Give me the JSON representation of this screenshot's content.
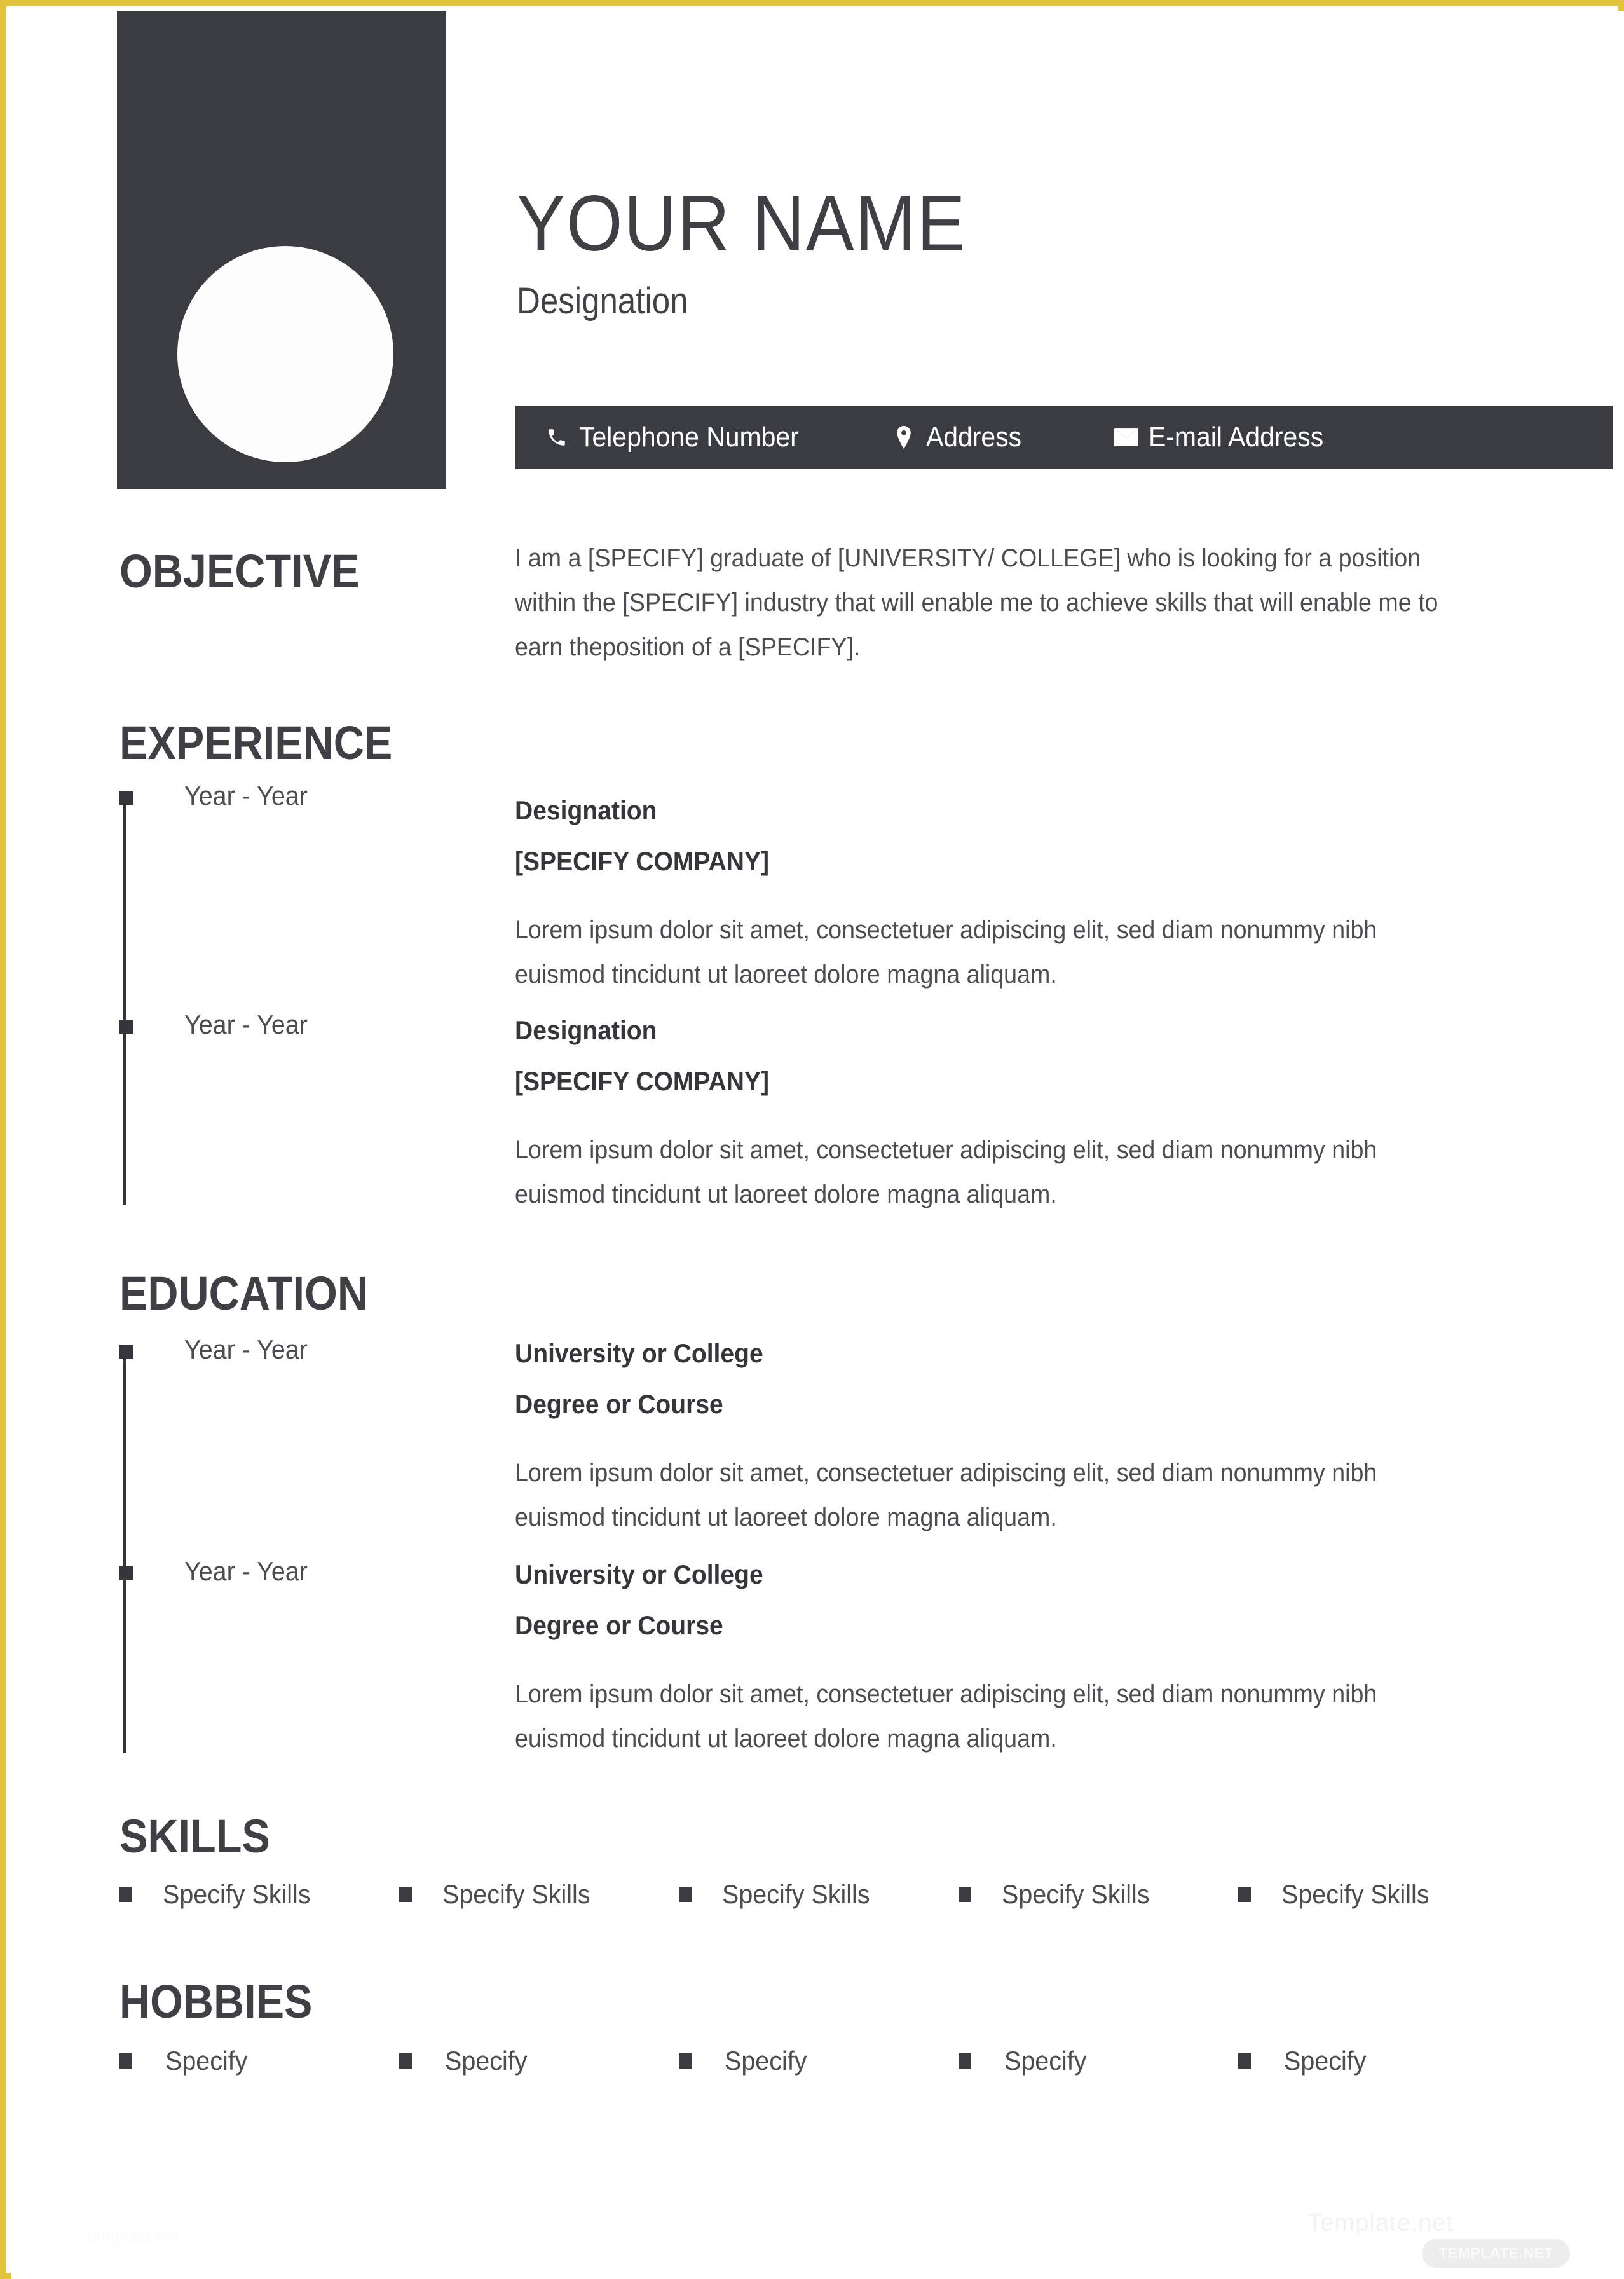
{
  "colors": {
    "frame_gold": "#e3c33c",
    "dark_panel": "#3b3c41",
    "heading_text": "#3f4045",
    "body_text": "#4b4c51",
    "page_background": "#ffffff"
  },
  "header": {
    "full_name": "YOUR NAME",
    "designation": "Designation",
    "photo_placeholder": "photo-circle"
  },
  "contact": {
    "items": [
      {
        "icon": "phone-icon",
        "label": "Telephone Number"
      },
      {
        "icon": "location-icon",
        "label": "Address"
      },
      {
        "icon": "envelope-icon",
        "label": "E-mail Address"
      }
    ]
  },
  "objective": {
    "heading": "OBJECTIVE",
    "text": "I am a [SPECIFY] graduate of [UNIVERSITY/ COLLEGE] who is looking for a position within the [SPECIFY] industry that will enable me to achieve skills that will enable me to earn theposition of a [SPECIFY]."
  },
  "experience": {
    "heading": "EXPERIENCE",
    "entries": [
      {
        "year": "Year - Year",
        "title": "Designation",
        "subtitle": "[SPECIFY COMPANY]",
        "description": "Lorem ipsum dolor sit amet, consectetuer adipiscing elit, sed diam nonummy nibh euismod tincidunt ut laoreet dolore magna aliquam."
      },
      {
        "year": "Year - Year",
        "title": "Designation",
        "subtitle": "[SPECIFY COMPANY]",
        "description": "Lorem ipsum dolor sit amet, consectetuer adipiscing elit, sed diam nonummy nibh euismod tincidunt ut laoreet dolore magna aliquam."
      }
    ]
  },
  "education": {
    "heading": "EDUCATION",
    "entries": [
      {
        "year": "Year - Year",
        "title": "University or College",
        "subtitle": "Degree or Course",
        "description": "Lorem ipsum dolor sit amet, consectetuer adipiscing elit, sed diam nonummy nibh euismod tincidunt ut laoreet dolore magna aliquam."
      },
      {
        "year": "Year - Year",
        "title": "University or College",
        "subtitle": "Degree or Course",
        "description": "Lorem ipsum dolor sit amet, consectetuer adipiscing elit, sed diam nonummy nibh euismod tincidunt ut laoreet dolore magna aliquam."
      }
    ]
  },
  "skills": {
    "heading": "SKILLS",
    "items": [
      "Specify Skills",
      "Specify Skills",
      "Specify Skills",
      "Specify Skills",
      "Specify Skills"
    ]
  },
  "hobbies": {
    "heading": "HOBBIES",
    "items": [
      "Specify",
      "Specify",
      "Specify",
      "Specify",
      "Specify"
    ]
  },
  "watermark": {
    "text": "Template.net",
    "badge": "TEMPLATE.NET",
    "bottom_left": "template.net"
  }
}
